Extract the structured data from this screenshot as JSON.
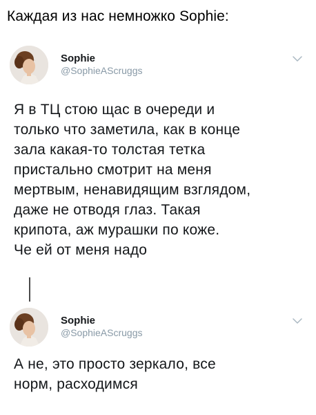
{
  "caption": "Каждая из нас немножко Sophie:",
  "tweets": [
    {
      "display_name": "Sophie",
      "handle": "@SophieAScruggs",
      "lines": [
        "Я в ТЦ стою щас в очереди и",
        "только что заметила, как в конце",
        "зала какая-то толстая тетка",
        "пристально смотрит на меня",
        "мертвым, ненавидящим взглядом,",
        "даже не отводя глаз. Такая",
        "крипота, аж мурашки по коже.",
        "Че ей от меня надо"
      ],
      "icons": {
        "avatar": "avatar-portrait-icon",
        "menu": "chevron-down-icon"
      }
    },
    {
      "display_name": "Sophie",
      "handle": "@SophieAScruggs",
      "lines": [
        "А не, это просто зеркало, все",
        "норм, расходимся"
      ],
      "icons": {
        "avatar": "avatar-portrait-icon",
        "menu": "chevron-down-icon"
      }
    }
  ],
  "colors": {
    "text": "#14171a",
    "handle": "#8899a6",
    "chevron": "#aab8c2",
    "thread_line": "#4a4a4a"
  }
}
